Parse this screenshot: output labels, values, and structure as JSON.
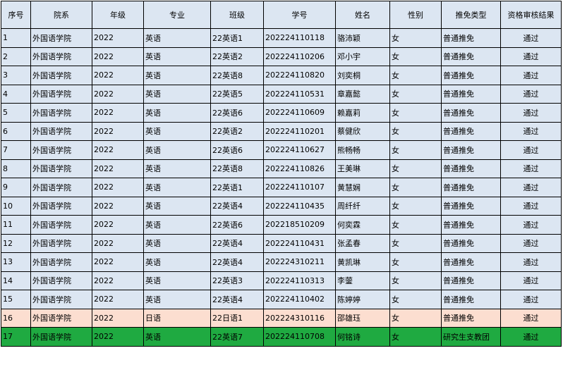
{
  "colors": {
    "header_bg": "#dce6f2",
    "row_bg": "#dce6f2",
    "row16_bg": "#fcded0",
    "row17_bg": "#1faa41"
  },
  "headers": [
    "序号",
    "院系",
    "年级",
    "专业",
    "班级",
    "学号",
    "姓名",
    "性别",
    "推免类型",
    "资格审核结果"
  ],
  "rows": [
    {
      "idx": "1",
      "dept": "外国语学院",
      "grade": "2022",
      "major": "英语",
      "class": "22英语1",
      "sid": "202224110118",
      "name": "骆沛颖",
      "gender": "女",
      "type": "普通推免",
      "result": "通过",
      "style": "default"
    },
    {
      "idx": "2",
      "dept": "外国语学院",
      "grade": "2022",
      "major": "英语",
      "class": "22英语2",
      "sid": "202224110206",
      "name": "邓小宇",
      "gender": "女",
      "type": "普通推免",
      "result": "通过",
      "style": "default"
    },
    {
      "idx": "3",
      "dept": "外国语学院",
      "grade": "2022",
      "major": "英语",
      "class": "22英语8",
      "sid": "202224110820",
      "name": "刘奕桐",
      "gender": "女",
      "type": "普通推免",
      "result": "通过",
      "style": "default"
    },
    {
      "idx": "4",
      "dept": "外国语学院",
      "grade": "2022",
      "major": "英语",
      "class": "22英语5",
      "sid": "202224110531",
      "name": "章嘉懿",
      "gender": "女",
      "type": "普通推免",
      "result": "通过",
      "style": "default"
    },
    {
      "idx": "5",
      "dept": "外国语学院",
      "grade": "2022",
      "major": "英语",
      "class": "22英语6",
      "sid": "202224110609",
      "name": "赖嘉莉",
      "gender": "女",
      "type": "普通推免",
      "result": "通过",
      "style": "default"
    },
    {
      "idx": "6",
      "dept": "外国语学院",
      "grade": "2022",
      "major": "英语",
      "class": "22英语2",
      "sid": "202224110201",
      "name": "蔡健欣",
      "gender": "女",
      "type": "普通推免",
      "result": "通过",
      "style": "default"
    },
    {
      "idx": "7",
      "dept": "外国语学院",
      "grade": "2022",
      "major": "英语",
      "class": "22英语6",
      "sid": "202224110627",
      "name": "熊畅畅",
      "gender": "女",
      "type": "普通推免",
      "result": "通过",
      "style": "default"
    },
    {
      "idx": "8",
      "dept": "外国语学院",
      "grade": "2022",
      "major": "英语",
      "class": "22英语8",
      "sid": "202224110826",
      "name": "王美琳",
      "gender": "女",
      "type": "普通推免",
      "result": "通过",
      "style": "default"
    },
    {
      "idx": "9",
      "dept": "外国语学院",
      "grade": "2022",
      "major": "英语",
      "class": "22英语1",
      "sid": "202224110107",
      "name": "黄慧娴",
      "gender": "女",
      "type": "普通推免",
      "result": "通过",
      "style": "default"
    },
    {
      "idx": "10",
      "dept": "外国语学院",
      "grade": "2022",
      "major": "英语",
      "class": "22英语4",
      "sid": "202224110435",
      "name": "周纤纤",
      "gender": "女",
      "type": "普通推免",
      "result": "通过",
      "style": "default"
    },
    {
      "idx": "11",
      "dept": "外国语学院",
      "grade": "2022",
      "major": "英语",
      "class": "22英语6",
      "sid": "202218510209",
      "name": "何奕霖",
      "gender": "女",
      "type": "普通推免",
      "result": "通过",
      "style": "default"
    },
    {
      "idx": "12",
      "dept": "外国语学院",
      "grade": "2022",
      "major": "英语",
      "class": "22英语4",
      "sid": "202224110431",
      "name": "张孟春",
      "gender": "女",
      "type": "普通推免",
      "result": "通过",
      "style": "default"
    },
    {
      "idx": "13",
      "dept": "外国语学院",
      "grade": "2022",
      "major": "英语",
      "class": "22英语4",
      "sid": "202224310211",
      "name": "黄凯琳",
      "gender": "女",
      "type": "普通推免",
      "result": "通过",
      "style": "default"
    },
    {
      "idx": "14",
      "dept": "外国语学院",
      "grade": "2022",
      "major": "英语",
      "class": "22英语3",
      "sid": "202224110313",
      "name": "李蓥",
      "gender": "女",
      "type": "普通推免",
      "result": "通过",
      "style": "default"
    },
    {
      "idx": "15",
      "dept": "外国语学院",
      "grade": "2022",
      "major": "英语",
      "class": "22英语4",
      "sid": "202224110402",
      "name": "陈婷婷",
      "gender": "女",
      "type": "普通推免",
      "result": "通过",
      "style": "default"
    },
    {
      "idx": "16",
      "dept": "外国语学院",
      "grade": "2022",
      "major": "日语",
      "class": "22日语1",
      "sid": "202224310116",
      "name": "邵雄珏",
      "gender": "女",
      "type": "普通推免",
      "result": "通过",
      "style": "peach"
    },
    {
      "idx": "17",
      "dept": "外国语学院",
      "grade": "2022",
      "major": "英语",
      "class": "22英语7",
      "sid": "202224110708",
      "name": "何铭诗",
      "gender": "女",
      "type": "研究生支教团",
      "result": "通过",
      "style": "green"
    }
  ]
}
